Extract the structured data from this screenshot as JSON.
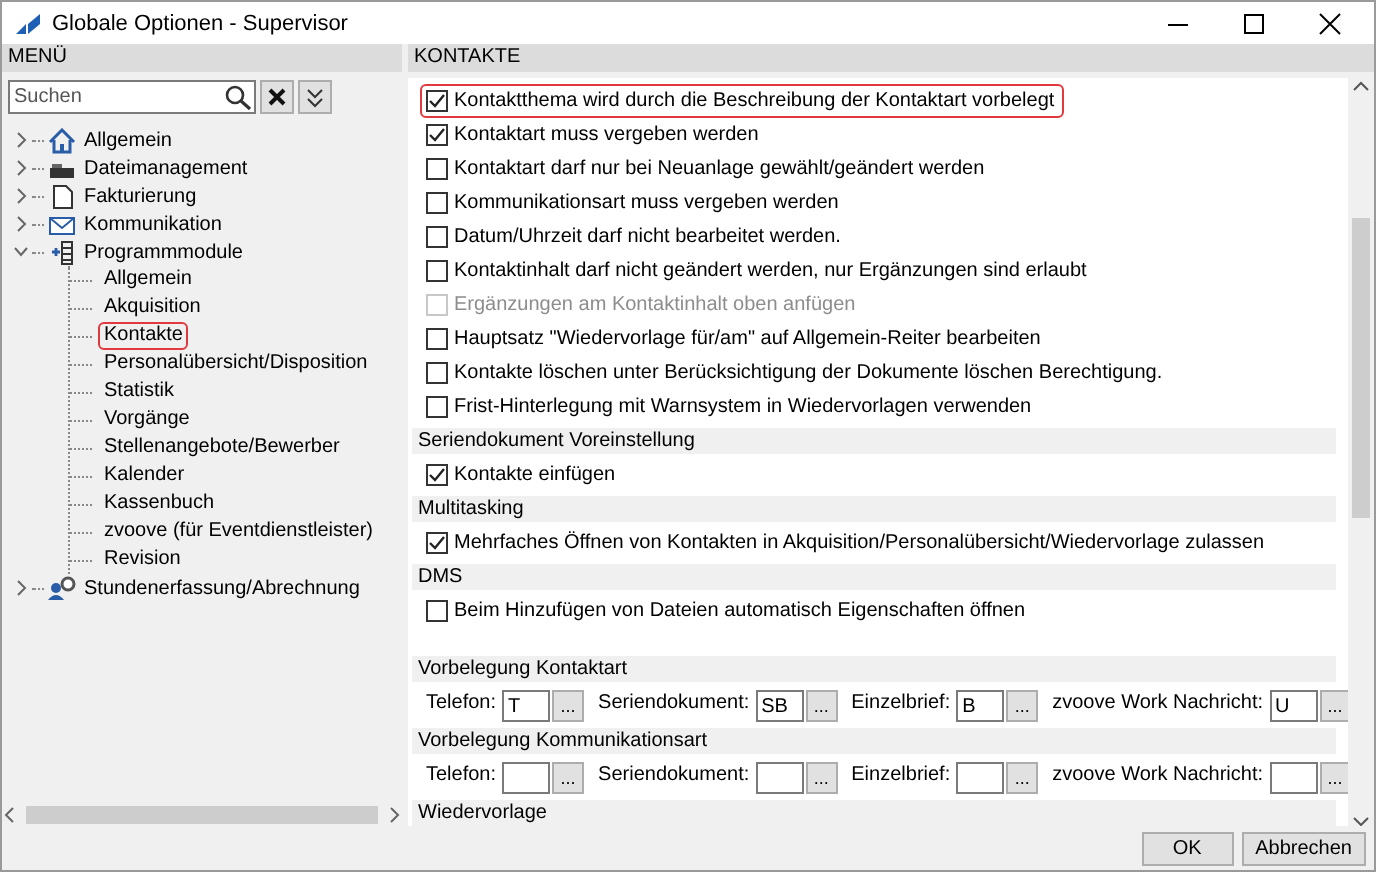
{
  "window": {
    "title": "Globale Optionen - Supervisor"
  },
  "menu": {
    "header": "MENÜ",
    "search": {
      "placeholder": "Suchen"
    },
    "tree": [
      {
        "label": "Allgemein",
        "expanded": false
      },
      {
        "label": "Dateimanagement",
        "expanded": false
      },
      {
        "label": "Fakturierung",
        "expanded": false
      },
      {
        "label": "Kommunikation",
        "expanded": false
      },
      {
        "label": "Programmmodule",
        "expanded": true,
        "children": [
          {
            "label": "Allgemein",
            "highlighted": false
          },
          {
            "label": "Akquisition",
            "highlighted": false
          },
          {
            "label": "Kontakte",
            "highlighted": true
          },
          {
            "label": "Personalübersicht/Disposition",
            "highlighted": false
          },
          {
            "label": "Statistik",
            "highlighted": false
          },
          {
            "label": "Vorgänge",
            "highlighted": false
          },
          {
            "label": "Stellenangebote/Bewerber",
            "highlighted": false
          },
          {
            "label": "Kalender",
            "highlighted": false
          },
          {
            "label": "Kassenbuch",
            "highlighted": false
          },
          {
            "label": "zvoove (für Eventdienstleister)",
            "highlighted": false
          },
          {
            "label": "Revision",
            "highlighted": false
          }
        ]
      },
      {
        "label": "Stundenerfassung/Abrechnung",
        "expanded": false
      }
    ]
  },
  "content": {
    "header": "KONTAKTE",
    "options": [
      {
        "label": "Kontaktthema wird durch die Beschreibung der Kontaktart vorbelegt",
        "checked": true,
        "disabled": false,
        "highlighted": true
      },
      {
        "label": "Kontaktart muss vergeben werden",
        "checked": true,
        "disabled": false,
        "highlighted": false
      },
      {
        "label": "Kontaktart darf nur bei Neuanlage gewählt/geändert werden",
        "checked": false,
        "disabled": false,
        "highlighted": false
      },
      {
        "label": "Kommunikationsart muss vergeben werden",
        "checked": false,
        "disabled": false,
        "highlighted": false
      },
      {
        "label": "Datum/Uhrzeit darf nicht bearbeitet werden.",
        "checked": false,
        "disabled": false,
        "highlighted": false
      },
      {
        "label": "Kontaktinhalt darf nicht geändert werden, nur Ergänzungen sind erlaubt",
        "checked": false,
        "disabled": false,
        "highlighted": false
      },
      {
        "label": "Ergänzungen am Kontaktinhalt oben anfügen",
        "checked": false,
        "disabled": true,
        "highlighted": false
      },
      {
        "label": "Hauptsatz \"Wiedervorlage für/am\" auf Allgemein-Reiter bearbeiten",
        "checked": false,
        "disabled": false,
        "highlighted": false
      },
      {
        "label": "Kontakte löschen unter Berücksichtigung der Dokumente löschen Berechtigung.",
        "checked": false,
        "disabled": false,
        "highlighted": false
      },
      {
        "label": "Frist-Hinterlegung mit Warnsystem in Wiedervorlagen verwenden",
        "checked": false,
        "disabled": false,
        "highlighted": false
      }
    ],
    "sections": [
      {
        "kind": "checks",
        "title": "Seriendokument Voreinstellung",
        "options": [
          {
            "label": "Kontakte einfügen",
            "checked": true,
            "disabled": false,
            "highlighted": false
          }
        ]
      },
      {
        "kind": "checks",
        "title": "Multitasking",
        "options": [
          {
            "label": "Mehrfaches Öffnen von Kontakten in Akquisition/Personalübersicht/Wiedervorlage zulassen",
            "checked": true,
            "disabled": false,
            "highlighted": false
          }
        ]
      },
      {
        "kind": "checks",
        "title": "DMS",
        "options": [
          {
            "label": "Beim Hinzufügen von Dateien automatisch Eigenschaften öffnen",
            "checked": false,
            "disabled": false,
            "highlighted": false
          }
        ]
      },
      {
        "kind": "fields",
        "title": "Vorbelegung Kontaktart",
        "fields": [
          {
            "label": "Telefon:",
            "value": "T",
            "button": "..."
          },
          {
            "label": "Seriendokument:",
            "value": "SB",
            "button": "..."
          },
          {
            "label": "Einzelbrief:",
            "value": "B",
            "button": "..."
          },
          {
            "label": "zvoove Work Nachricht:",
            "value": "U",
            "button": "..."
          }
        ]
      },
      {
        "kind": "fields",
        "title": "Vorbelegung Kommunikationsart",
        "fields": [
          {
            "label": "Telefon:",
            "button": "..."
          },
          {
            "label": "Seriendokument:",
            "button": "..."
          },
          {
            "label": "Einzelbrief:",
            "button": "..."
          },
          {
            "label": "zvoove Work Nachricht:",
            "button": "..."
          }
        ]
      },
      {
        "kind": "checks",
        "title": "Wiedervorlage"
      }
    ]
  },
  "buttons": [
    "OK",
    "Abbrechen"
  ]
}
